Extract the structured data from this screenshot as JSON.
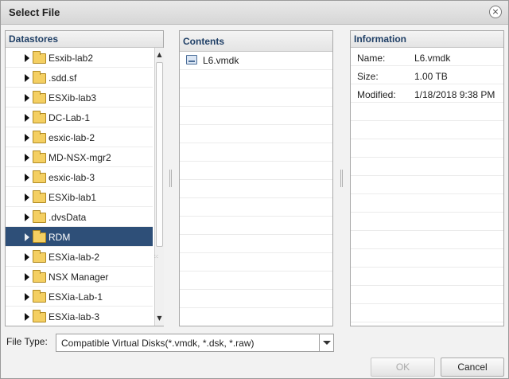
{
  "dialog": {
    "title": "Select File",
    "close_glyph": "×"
  },
  "datastores": {
    "header": "Datastores",
    "items": [
      {
        "label": "Esxib-lab2",
        "icon": "folder-icon",
        "selected": false
      },
      {
        "label": ".sdd.sf",
        "icon": "folder-icon",
        "selected": false
      },
      {
        "label": "ESXib-lab3",
        "icon": "folder-icon",
        "selected": false
      },
      {
        "label": "DC-Lab-1",
        "icon": "folder-icon",
        "selected": false
      },
      {
        "label": "esxic-lab-2",
        "icon": "folder-icon",
        "selected": false
      },
      {
        "label": "MD-NSX-mgr2",
        "icon": "folder-icon",
        "selected": false
      },
      {
        "label": "esxic-lab-3",
        "icon": "folder-icon",
        "selected": false
      },
      {
        "label": "ESXib-lab1",
        "icon": "folder-icon",
        "selected": false
      },
      {
        "label": ".dvsData",
        "icon": "folder-icon",
        "selected": false
      },
      {
        "label": "RDM",
        "icon": "folder-icon",
        "selected": true
      },
      {
        "label": "ESXia-lab-2",
        "icon": "folder-icon",
        "selected": false
      },
      {
        "label": "NSX Manager",
        "icon": "folder-icon",
        "selected": false
      },
      {
        "label": "ESXia-Lab-1",
        "icon": "folder-icon",
        "selected": false
      },
      {
        "label": "ESXia-lab-3",
        "icon": "folder-icon",
        "selected": false
      }
    ],
    "scroll_up_glyph": "▲",
    "scroll_down_glyph": "▼",
    "grip_glyph": "⁙"
  },
  "contents": {
    "header": "Contents",
    "files": [
      {
        "label": "L6.vmdk",
        "icon": "virtual-disk-icon"
      }
    ]
  },
  "information": {
    "header": "Information",
    "rows": [
      {
        "key": "Name:",
        "value": "L6.vmdk"
      },
      {
        "key": "Size:",
        "value": "1.00 TB"
      },
      {
        "key": "Modified:",
        "value": "1/18/2018 9:38 PM"
      }
    ]
  },
  "file_type": {
    "label": "File Type:",
    "selected": "Compatible Virtual Disks(*.vmdk, *.dsk, *.raw)"
  },
  "buttons": {
    "ok": "OK",
    "cancel": "Cancel"
  },
  "colors": {
    "selection": "#2e4f78",
    "header_text": "#1f3f66"
  }
}
